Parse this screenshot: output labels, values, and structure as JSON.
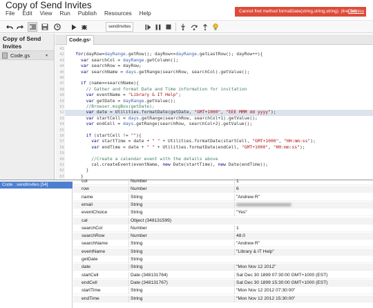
{
  "app": {
    "title": "Copy of Send Invites",
    "menu": [
      "File",
      "Edit",
      "View",
      "Run",
      "Publish",
      "Resources",
      "Help"
    ],
    "error_message": "Cannot find method formatDate(string,string,string). (line 54)",
    "dismiss_label": "Dismiss"
  },
  "toolbar": {
    "function_select": "sendInvites"
  },
  "sidebar": {
    "project_name": "Copy of Send Invites",
    "files": [
      {
        "name": "Code.gs"
      }
    ]
  },
  "editor": {
    "tab_label": "Code.gs",
    "tab_close": "x",
    "line_numbers": [
      "41",
      "42",
      "43",
      "44",
      "45",
      "46",
      "47",
      "48",
      "49",
      "50",
      "51",
      "52",
      "53",
      "54",
      "55",
      "56",
      "57",
      "58",
      "59",
      "60",
      "61",
      "62",
      "63",
      "64",
      "65"
    ],
    "lines": [
      "",
      "    for(dayRow=dayRange.getRow(); dayRow<=dayRange.getLastRow(); dayRow++){",
      "      var searchCol = dayRange.getColumn();",
      "      var searchRow = dayRow;",
      "      var searchName = days.getRange(searchRow, searchCol).getValue();",
      "",
      "      if (name==searchName){",
      "        // Gather and format Date and Time information for invitation",
      "        var eventName = \"Library & IT Help\";",
      "        var getDate = dayRange.getValue();",
      "        //Browser.msgBox(getDate);",
      "        var date = Utilities.formatDate(getDate, \"GMT+1000\", \"EEE MMM dd yyyy\");",
      "        var startCell = days.getRange(searchRow, searchCol+1).getValue();",
      "        var endCell = days.getRange(searchRow, searchCol+2).getValue();",
      "",
      "        if (startCell != \"\"){",
      "          var startTime = date + \" \" + Utilities.formatDate(startCell, \"GMT+1000\", \"HH:mm:ss\");",
      "          var endTime = date + \" \" + Utilities.formatDate(endCell, \"GMT+1000\", \"HH:mm:ss\");",
      "",
      "          //Create a calendar event with the details above",
      "          cal.createEvent(eventName, new Date(startTime), new Date(endTime));",
      "        }",
      "      }",
      "    }",
      "  }"
    ],
    "closing_brace": "}"
  },
  "debugger": {
    "stack": [
      "Code : sendInvites [54]"
    ],
    "variables": [
      {
        "name": "col",
        "type": "Number",
        "value": "1"
      },
      {
        "name": "row",
        "type": "Number",
        "value": "6"
      },
      {
        "name": "name",
        "type": "String",
        "value": "\"Andrew R\""
      },
      {
        "name": "email",
        "type": "String",
        "value": ""
      },
      {
        "name": "eventChoice",
        "type": "String",
        "value": "\"Yes\""
      },
      {
        "name": "cal",
        "type": "Object (348131599)",
        "value": ""
      },
      {
        "name": "searchCol",
        "type": "Number",
        "value": "1"
      },
      {
        "name": "searchRow",
        "type": "Number",
        "value": "48.0"
      },
      {
        "name": "searchName",
        "type": "String",
        "value": "\"Andrew R\""
      },
      {
        "name": "eventName",
        "type": "String",
        "value": "\"Library & IT Help\""
      },
      {
        "name": "getDate",
        "type": "String",
        "value": ""
      },
      {
        "name": "date",
        "type": "String",
        "value": "\"Mon Nov 12 2012\""
      },
      {
        "name": "startCell",
        "type": "Date (348131764)",
        "value": "Sat Dec 30 1899 07:30:00 GMT+1000 (EST)"
      },
      {
        "name": "endCell",
        "type": "Date (348131767)",
        "value": "Sat Dec 30 1899 15:30:00 GMT+1000 (EST)"
      },
      {
        "name": "startTime",
        "type": "String",
        "value": "\"Mon Nov 12 2012 07:30:00\""
      },
      {
        "name": "endTime",
        "type": "String",
        "value": "\"Mon Nov 12 2012 15:30:00\""
      }
    ]
  },
  "colors": {
    "error_bg": "#dd4b39",
    "stack_selected": "#4d7fd0",
    "highlight_line": "#dde3ec",
    "comment": "#3f7f5f",
    "string": "#aa1111",
    "keyword": "#00007f"
  },
  "icons": [
    "undo-icon",
    "redo-icon",
    "indent-icon",
    "save-icon",
    "triggers-icon",
    "run-icon",
    "debug-icon",
    "continue-icon",
    "pause-icon",
    "stop-icon",
    "step-into-icon",
    "step-over-icon",
    "step-out-icon",
    "lightbulb-icon"
  ]
}
